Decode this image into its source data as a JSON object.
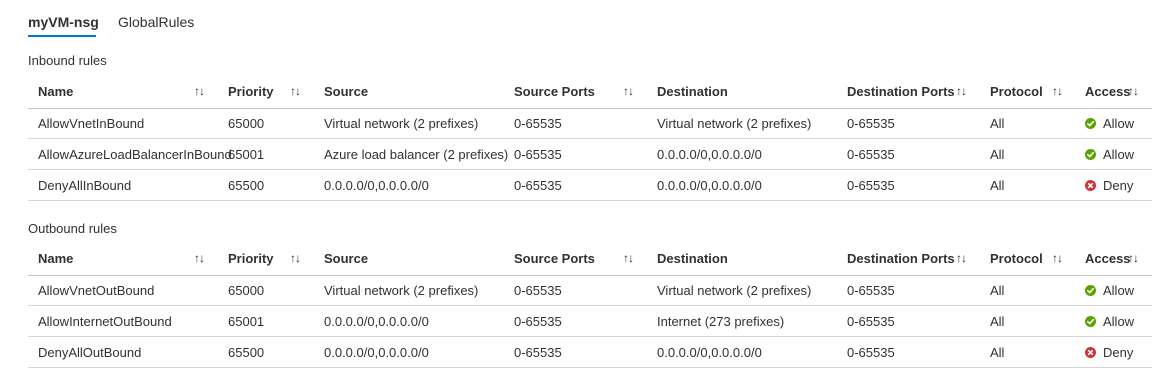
{
  "tabs": [
    {
      "label": "myVM-nsg",
      "active": true
    },
    {
      "label": "GlobalRules",
      "active": false
    }
  ],
  "columns": {
    "name": "Name",
    "priority": "Priority",
    "source": "Source",
    "source_ports": "Source Ports",
    "destination": "Destination",
    "destination_ports": "Destination Ports",
    "protocol": "Protocol",
    "access": "Access"
  },
  "sort_glyph": "↑↓",
  "colors": {
    "accent": "#0078d4",
    "allow": "#57a300",
    "deny": "#d13438"
  },
  "inbound": {
    "title": "Inbound rules",
    "rows": [
      {
        "name": "AllowVnetInBound",
        "priority": "65000",
        "source": "Virtual network (2 prefixes)",
        "source_ports": "0-65535",
        "destination": "Virtual network (2 prefixes)",
        "destination_ports": "0-65535",
        "protocol": "All",
        "access": "Allow",
        "access_icon": "check-circle-icon"
      },
      {
        "name": "AllowAzureLoadBalancerInBound",
        "priority": "65001",
        "source": "Azure load balancer (2 prefixes)",
        "source_ports": "0-65535",
        "destination": "0.0.0.0/0,0.0.0.0/0",
        "destination_ports": "0-65535",
        "protocol": "All",
        "access": "Allow",
        "access_icon": "check-circle-icon"
      },
      {
        "name": "DenyAllInBound",
        "priority": "65500",
        "source": "0.0.0.0/0,0.0.0.0/0",
        "source_ports": "0-65535",
        "destination": "0.0.0.0/0,0.0.0.0/0",
        "destination_ports": "0-65535",
        "protocol": "All",
        "access": "Deny",
        "access_icon": "x-circle-icon"
      }
    ]
  },
  "outbound": {
    "title": "Outbound rules",
    "rows": [
      {
        "name": "AllowVnetOutBound",
        "priority": "65000",
        "source": "Virtual network (2 prefixes)",
        "source_ports": "0-65535",
        "destination": "Virtual network (2 prefixes)",
        "destination_ports": "0-65535",
        "protocol": "All",
        "access": "Allow",
        "access_icon": "check-circle-icon"
      },
      {
        "name": "AllowInternetOutBound",
        "priority": "65001",
        "source": "0.0.0.0/0,0.0.0.0/0",
        "source_ports": "0-65535",
        "destination": "Internet (273 prefixes)",
        "destination_ports": "0-65535",
        "protocol": "All",
        "access": "Allow",
        "access_icon": "check-circle-icon"
      },
      {
        "name": "DenyAllOutBound",
        "priority": "65500",
        "source": "0.0.0.0/0,0.0.0.0/0",
        "source_ports": "0-65535",
        "destination": "0.0.0.0/0,0.0.0.0/0",
        "destination_ports": "0-65535",
        "protocol": "All",
        "access": "Deny",
        "access_icon": "x-circle-icon"
      }
    ]
  }
}
